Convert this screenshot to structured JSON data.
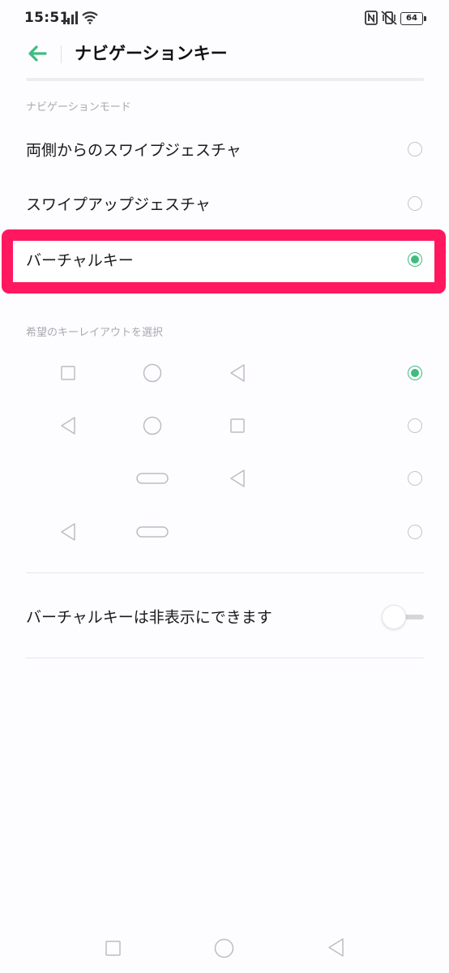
{
  "status_bar": {
    "time": "15:51",
    "battery": "64",
    "icons": [
      "signal-icon",
      "wifi-icon",
      "nfc-icon",
      "vibrate-icon",
      "battery-icon"
    ]
  },
  "header": {
    "title": "ナビゲーションキー",
    "back_icon": "back-arrow-icon",
    "accent_color": "#3fbc7e"
  },
  "navigation_mode": {
    "section_label": "ナビゲーションモード",
    "options": [
      {
        "label": "両側からのスワイプジェスチャ",
        "selected": false
      },
      {
        "label": "スワイプアップジェスチャ",
        "selected": false
      },
      {
        "label": "バーチャルキー",
        "selected": true
      }
    ],
    "highlight_color": "#ff1860"
  },
  "key_layout": {
    "section_label": "希望のキーレイアウトを選択",
    "layouts": [
      {
        "keys": [
          "square-icon",
          "circle-icon",
          "triangle-back-icon"
        ],
        "selected": true
      },
      {
        "keys": [
          "triangle-back-icon",
          "circle-icon",
          "square-icon"
        ],
        "selected": false
      },
      {
        "keys": [
          "",
          "pill-icon",
          "triangle-back-icon"
        ],
        "selected": false
      },
      {
        "keys": [
          "triangle-back-icon",
          "pill-icon",
          ""
        ],
        "selected": false
      }
    ]
  },
  "hide_keys": {
    "label": "バーチャルキーは非表示にできます",
    "enabled": false
  },
  "system_nav": {
    "keys": [
      "square-icon",
      "circle-icon",
      "triangle-back-icon"
    ]
  }
}
